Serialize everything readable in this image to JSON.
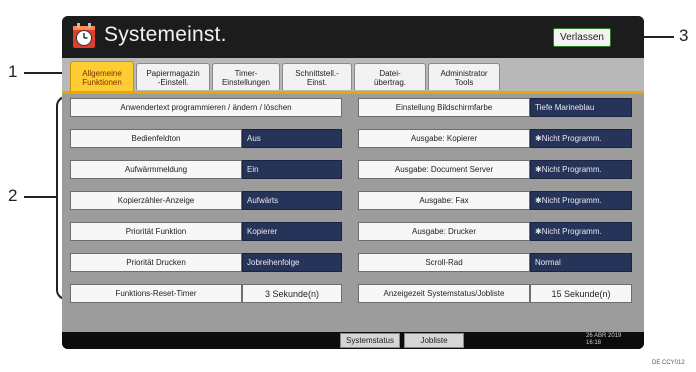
{
  "window": {
    "title": "Systemeinst.",
    "exit_label": "Verlassen"
  },
  "tabs": [
    {
      "line1": "Allgemeine",
      "line2": "Funktionen",
      "active": true
    },
    {
      "line1": "Papiermagazin",
      "line2": "-Einstell."
    },
    {
      "line1": "Timer-",
      "line2": "Einstellungen"
    },
    {
      "line1": "Schnittstell.-",
      "line2": "Einst."
    },
    {
      "line1": "Datei-",
      "line2": "übertrag."
    },
    {
      "line1": "Administrator",
      "line2": "Tools"
    }
  ],
  "left_settings": [
    {
      "label": "Anwendertext programmieren / ändern / löschen"
    },
    {
      "label": "Bedienfeldton",
      "value": "Aus"
    },
    {
      "label": "Aufwärmmeldung",
      "value": "Ein"
    },
    {
      "label": "Kopierzähler-Anzeige",
      "value": "Aufwärts"
    },
    {
      "label": "Priorität Funktion",
      "value": "Kopierer"
    },
    {
      "label": "Priorität Drucken",
      "value": "Jobreihenfolge"
    },
    {
      "label": "Funktions-Reset-Timer",
      "value": "3 Sekunde(n)"
    }
  ],
  "right_settings": [
    {
      "label": "Einstellung Bildschirmfarbe",
      "value": "Tiefe Marineblau"
    },
    {
      "label": "Ausgabe: Kopierer",
      "value": "✱Nicht Programm."
    },
    {
      "label": "Ausgabe: Document Server",
      "value": "✱Nicht Programm."
    },
    {
      "label": "Ausgabe: Fax",
      "value": "✱Nicht Programm."
    },
    {
      "label": "Ausgabe: Drucker",
      "value": "✱Nicht Programm."
    },
    {
      "label": "Scroll-Rad",
      "value": "Normal"
    },
    {
      "label": "Anzeigezeit Systemstatus/Jobliste",
      "value": "15 Sekunde(n)"
    }
  ],
  "status_bar": {
    "system_status": "Systemstatus",
    "job_list": "Jobliste",
    "date": "26 ABR 2019",
    "time": "16:18"
  },
  "callouts": {
    "one": "1",
    "two": "2",
    "three": "3"
  },
  "figure_code": "DE CCY012",
  "colors": {
    "active_tab": "#ffcc33",
    "value_field": "#27345a",
    "accent_underline": "#e8a800"
  }
}
